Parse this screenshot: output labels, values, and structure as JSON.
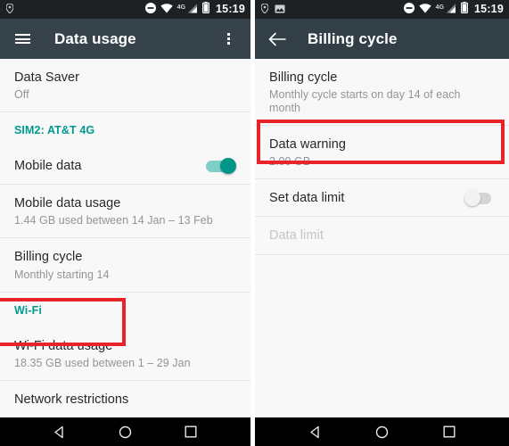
{
  "status_bar": {
    "notification_icons": [
      "location-pin-icon",
      "screenshot-image-icon"
    ],
    "system_icons": [
      "do-not-disturb-icon",
      "wifi-icon",
      "mobile-signal-icon",
      "battery-icon"
    ],
    "network_label": "4G",
    "time": "15:19"
  },
  "left_screen": {
    "toolbar": {
      "menu_icon": "hamburger-menu-icon",
      "title": "Data usage",
      "overflow_icon": "more-options-icon"
    },
    "rows": [
      {
        "title": "Data Saver",
        "subtitle": "Off"
      },
      {
        "title": "Mobile data usage",
        "subtitle": "1.44 GB used between 14 Jan – 13 Feb"
      },
      {
        "title": "Billing cycle",
        "subtitle": "Monthly starting 14"
      },
      {
        "title": "Wi-Fi data usage",
        "subtitle": "18.35 GB used between 1 – 29 Jan"
      },
      {
        "title": "Network restrictions",
        "subtitle": ""
      }
    ],
    "sim_section_header": "SIM2: AT&T 4G",
    "wifi_section_header": "Wi-Fi",
    "mobile_data": {
      "label": "Mobile data",
      "toggle_state": "on"
    }
  },
  "right_screen": {
    "toolbar": {
      "back_icon": "back-arrow-icon",
      "title": "Billing cycle"
    },
    "rows": [
      {
        "title": "Billing cycle",
        "subtitle": "Monthly cycle starts on day 14 of each month"
      },
      {
        "title": "Data warning",
        "subtitle": "2.00 GB"
      },
      {
        "title": "Data limit",
        "subtitle": ""
      }
    ],
    "set_data_limit": {
      "label": "Set data limit",
      "toggle_state": "off"
    }
  },
  "nav_bar": {
    "back": "nav-back-icon",
    "home": "nav-home-icon",
    "recents": "nav-recents-icon"
  },
  "colors": {
    "toolbar": "#36434b",
    "status_bar": "#1e2124",
    "accent_teal": "#009688",
    "section_header_teal": "#009b8e",
    "highlight_red": "#e8232a",
    "list_background": "#f8f8f8",
    "nav_bar": "#000000"
  }
}
